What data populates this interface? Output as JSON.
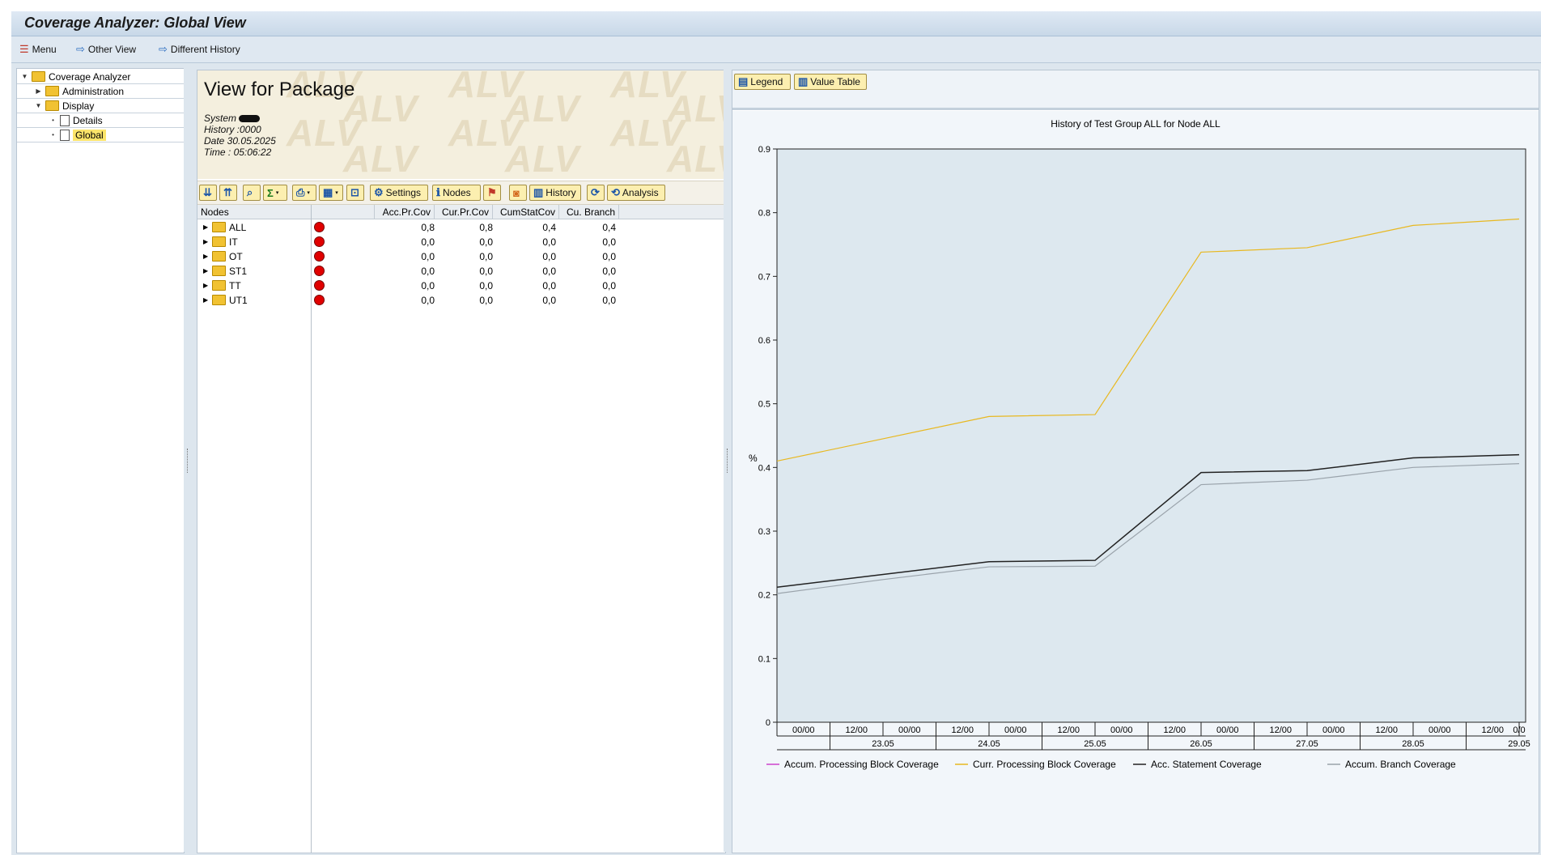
{
  "window": {
    "title": "Coverage Analyzer: Global View"
  },
  "toolbar": {
    "menu": "Menu",
    "other_view": "Other View",
    "different_history": "Different History"
  },
  "tree": {
    "root": "Coverage Analyzer",
    "administration": "Administration",
    "display": "Display",
    "details": "Details",
    "global": "Global"
  },
  "header": {
    "title": "View for Package",
    "system_label": "System",
    "history": "History :0000",
    "date": "Date 30.05.2025",
    "time": "Time : 05:06:22",
    "watermark": "ALV"
  },
  "alv_toolbar": {
    "settings": "Settings",
    "nodes": "Nodes",
    "history": "History",
    "analysis": "Analysis"
  },
  "grid": {
    "columns": [
      "Nodes",
      "",
      "Acc.Pr.Cov",
      "Cur.Pr.Cov",
      "CumStatCov",
      "Cu. Branch"
    ],
    "rows": [
      {
        "node": "ALL",
        "acc": "0,8",
        "cur": "0,8",
        "cum": "0,4",
        "branch": "0,4"
      },
      {
        "node": "IT",
        "acc": "0,0",
        "cur": "0,0",
        "cum": "0,0",
        "branch": "0,0"
      },
      {
        "node": "OT",
        "acc": "0,0",
        "cur": "0,0",
        "cum": "0,0",
        "branch": "0,0"
      },
      {
        "node": "ST1",
        "acc": "0,0",
        "cur": "0,0",
        "cum": "0,0",
        "branch": "0,0"
      },
      {
        "node": "TT",
        "acc": "0,0",
        "cur": "0,0",
        "cum": "0,0",
        "branch": "0,0"
      },
      {
        "node": "UT1",
        "acc": "0,0",
        "cur": "0,0",
        "cum": "0,0",
        "branch": "0,0"
      }
    ]
  },
  "right_toolbar": {
    "legend": "Legend",
    "value_table": "Value Table"
  },
  "chart_data": {
    "type": "line",
    "title": "History of Test Group ALL  for Node ALL",
    "ylabel": "%",
    "ylim": [
      0,
      0.9
    ],
    "yticks": [
      "0",
      "0.1",
      "0.2",
      "0.3",
      "0.4",
      "0.5",
      "0.6",
      "0.7",
      "0.8",
      "0.9"
    ],
    "grid": false,
    "legend_placement": "bottom",
    "time_labels": [
      "00/00",
      "12/00",
      "00/00",
      "12/00",
      "00/00",
      "12/00",
      "00/00",
      "12/00",
      "00/00",
      "12/00",
      "00/00",
      "12/00",
      "00/00",
      "12/00",
      "0/0"
    ],
    "date_labels": [
      "23.05",
      "24.05",
      "25.05",
      "26.05",
      "27.05",
      "28.05",
      "29.05"
    ],
    "x": [
      0,
      2,
      4,
      6,
      8,
      10,
      12,
      14
    ],
    "series": [
      {
        "name": "Accum. Processing Block Coverage",
        "color": "#cc44cc",
        "values": []
      },
      {
        "name": "Curr. Processing Block Coverage",
        "color": "#e8b820",
        "values": [
          0.41,
          0.445,
          0.48,
          0.483,
          0.738,
          0.745,
          0.78,
          0.79
        ]
      },
      {
        "name": "Acc. Statement Coverage",
        "color": "#222222",
        "values": [
          0.212,
          0.232,
          0.252,
          0.254,
          0.392,
          0.395,
          0.415,
          0.42
        ]
      },
      {
        "name": "Accum. Branch Coverage",
        "color": "#9aa3ab",
        "values": [
          0.202,
          0.224,
          0.244,
          0.245,
          0.373,
          0.38,
          0.4,
          0.406
        ]
      }
    ]
  }
}
